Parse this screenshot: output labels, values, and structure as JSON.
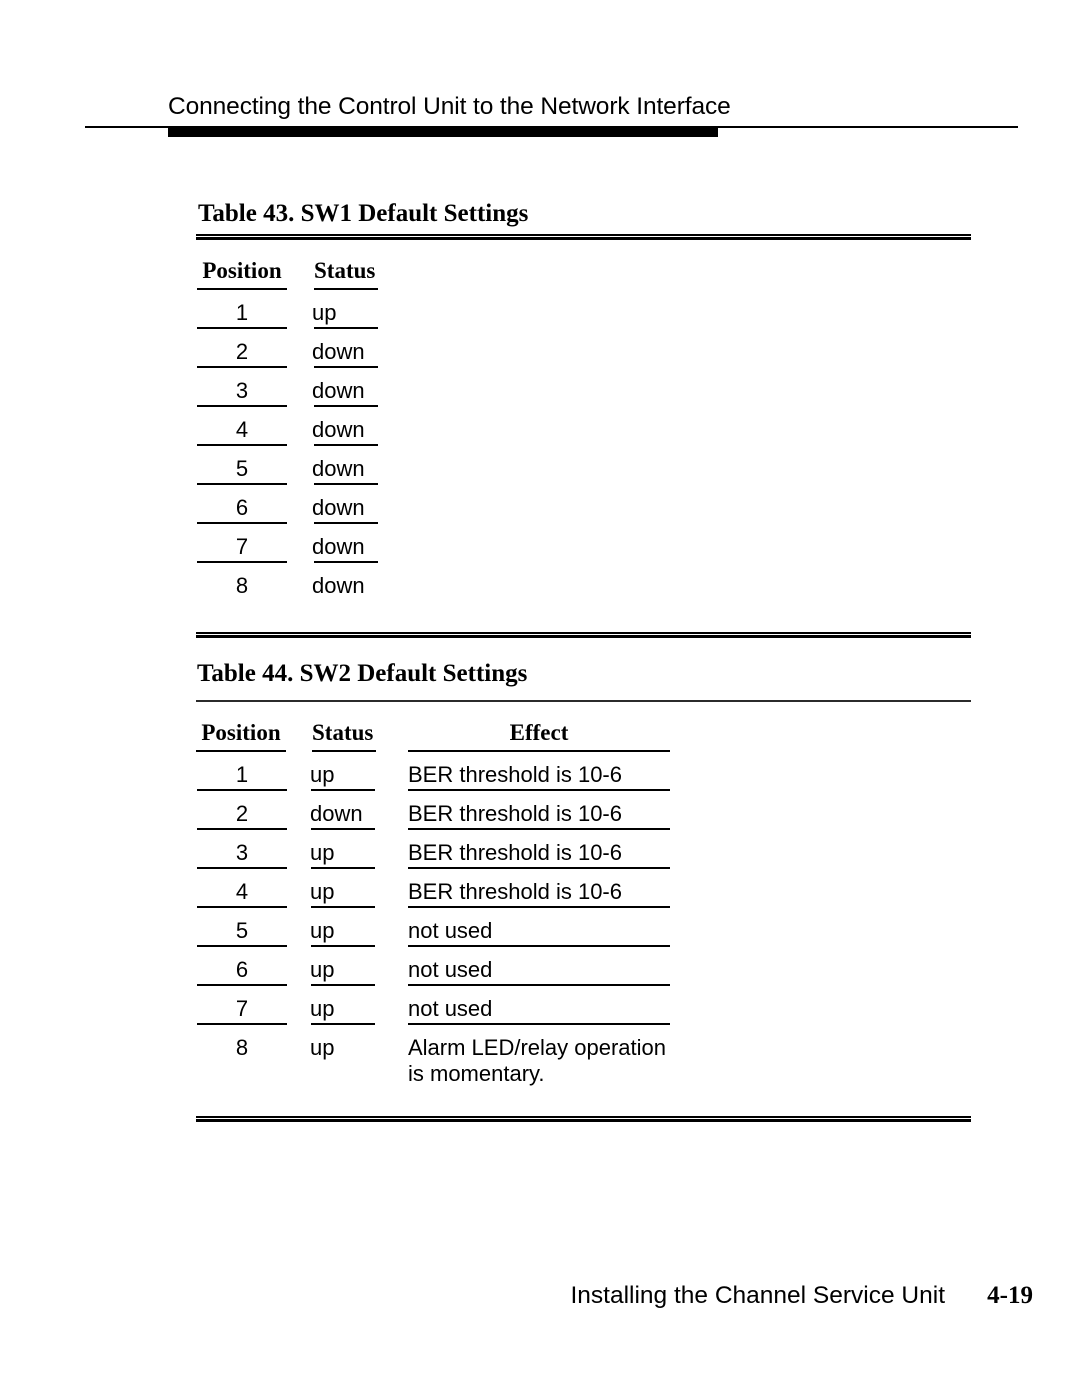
{
  "header": {
    "running_title": "Connecting the Control Unit to the Network Interface"
  },
  "tables": [
    {
      "caption": "Table  43.  SW1 Default Settings",
      "columns": [
        "Position",
        "Status"
      ],
      "rows": [
        {
          "position": "1",
          "status": "up"
        },
        {
          "position": "2",
          "status": "down"
        },
        {
          "position": "3",
          "status": "down"
        },
        {
          "position": "4",
          "status": "down"
        },
        {
          "position": "5",
          "status": "down"
        },
        {
          "position": "6",
          "status": "down"
        },
        {
          "position": "7",
          "status": "down"
        },
        {
          "position": "8",
          "status": "down"
        }
      ]
    },
    {
      "caption": "Table 44.  SW2 Default Settings",
      "columns": [
        "Position",
        "Status",
        "Effect"
      ],
      "rows": [
        {
          "position": "1",
          "status": "up",
          "effect": "BER threshold is 10-6"
        },
        {
          "position": "2",
          "status": "down",
          "effect": "BER threshold is 10-6"
        },
        {
          "position": "3",
          "status": "up",
          "effect": "BER threshold is 10-6"
        },
        {
          "position": "4",
          "status": "up",
          "effect": "BER threshold is 10-6"
        },
        {
          "position": "5",
          "status": "up",
          "effect": "not used"
        },
        {
          "position": "6",
          "status": "up",
          "effect": "not used"
        },
        {
          "position": "7",
          "status": "up",
          "effect": "not used"
        },
        {
          "position": "8",
          "status": "up",
          "effect": "Alarm  LED/relay  operation",
          "effect_line2": "is  momentary."
        }
      ]
    }
  ],
  "footer": {
    "section_title": "Installing the Channel Service Unit",
    "page_number": "4-19"
  }
}
